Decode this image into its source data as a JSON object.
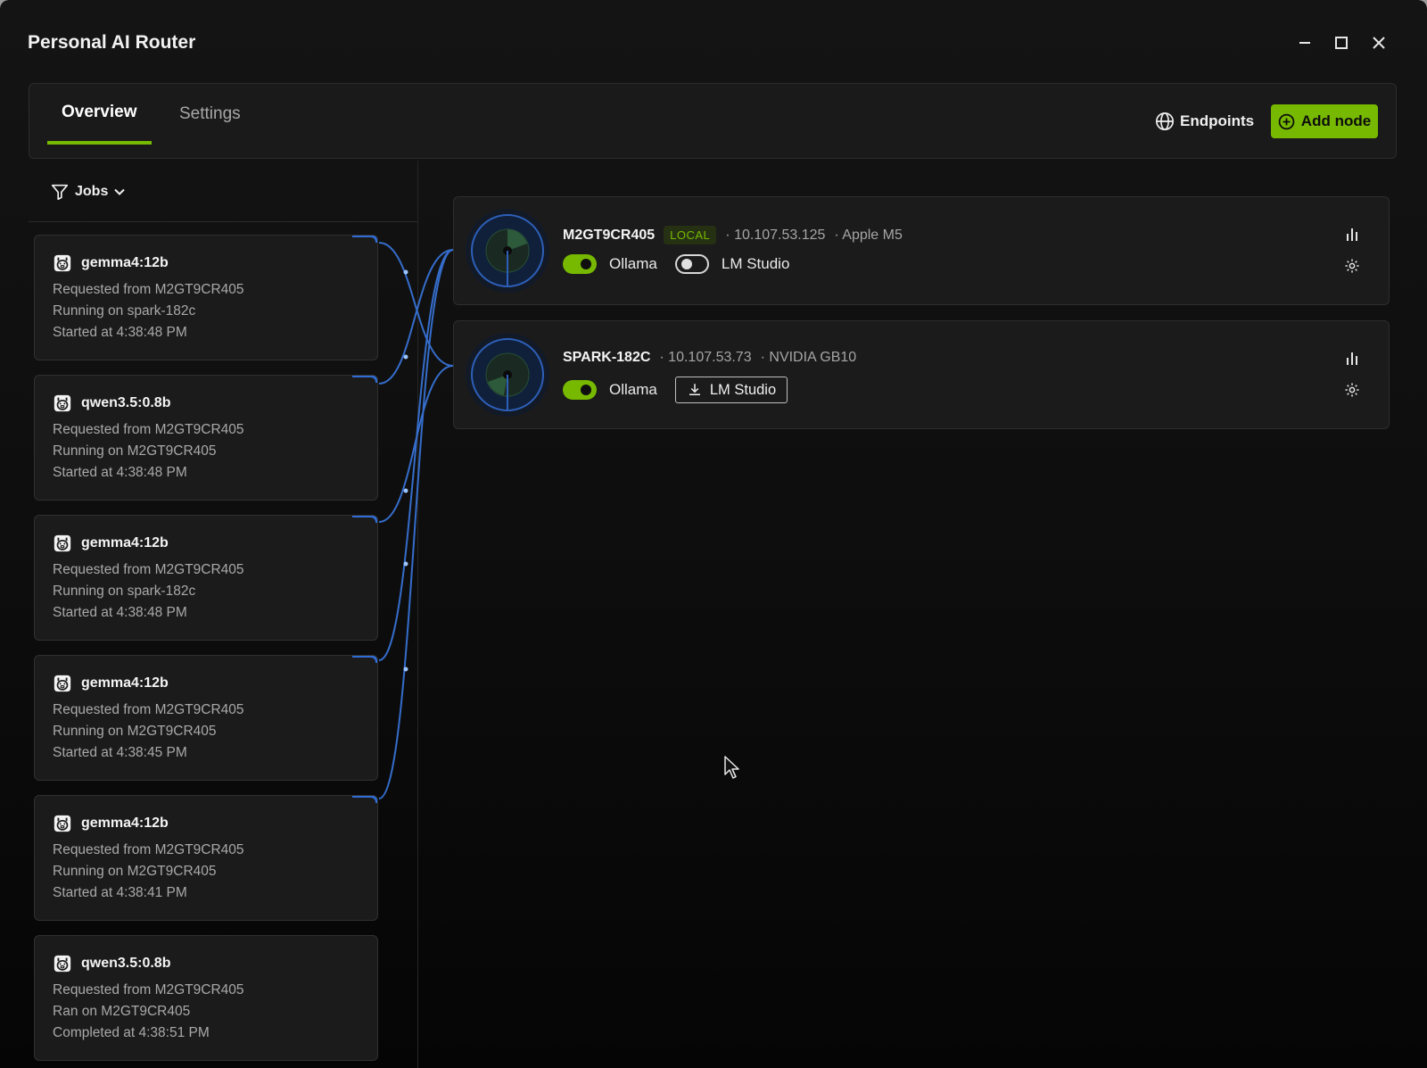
{
  "window": {
    "title": "Personal AI Router"
  },
  "tabs": [
    {
      "label": "Overview",
      "active": true
    },
    {
      "label": "Settings",
      "active": false
    }
  ],
  "toolbar": {
    "endpoints_label": "Endpoints",
    "add_node_label": "Add node"
  },
  "filter": {
    "label": "Jobs"
  },
  "jobs": [
    {
      "model": "gemma4:12b",
      "requested": "Requested from M2GT9CR405",
      "running": "Running on spark-182c",
      "time": "Started at 4:38:48 PM"
    },
    {
      "model": "qwen3.5:0.8b",
      "requested": "Requested from M2GT9CR405",
      "running": "Running on M2GT9CR405",
      "time": "Started at 4:38:48 PM"
    },
    {
      "model": "gemma4:12b",
      "requested": "Requested from M2GT9CR405",
      "running": "Running on spark-182c",
      "time": "Started at 4:38:48 PM"
    },
    {
      "model": "gemma4:12b",
      "requested": "Requested from M2GT9CR405",
      "running": "Running on M2GT9CR405",
      "time": "Started at 4:38:45 PM"
    },
    {
      "model": "gemma4:12b",
      "requested": "Requested from M2GT9CR405",
      "running": "Running on M2GT9CR405",
      "time": "Started at 4:38:41 PM"
    },
    {
      "model": "qwen3.5:0.8b",
      "requested": "Requested from M2GT9CR405",
      "running": "Ran on M2GT9CR405",
      "time": "Completed at 4:38:51 PM"
    }
  ],
  "nodes": [
    {
      "name": "M2GT9CR405",
      "badge": "LOCAL",
      "ip": "· 10.107.53.125",
      "hardware": "· Apple M5",
      "ollama_label": "Ollama",
      "ollama_enabled": true,
      "lm_studio_label": "LM Studio",
      "lm_studio_enabled": false
    },
    {
      "name": "SPARK-182C",
      "ip": "· 10.107.53.73",
      "hardware": "· NVIDIA GB10",
      "ollama_label": "Ollama",
      "ollama_enabled": true,
      "lm_studio_label": "LM Studio",
      "lm_studio_action": "install"
    }
  ],
  "colors": {
    "accent": "#76b900",
    "connector": "#3a78e0",
    "background": "#0d0d0d"
  }
}
